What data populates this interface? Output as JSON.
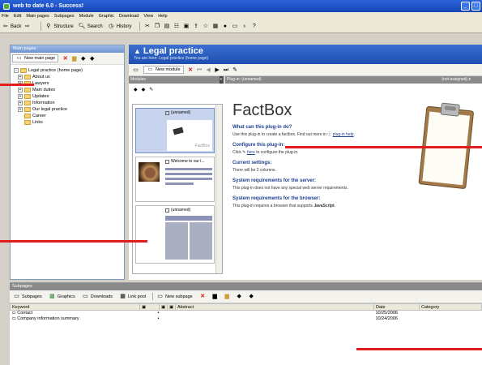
{
  "window": {
    "title": "web to date 6.0 - Success!"
  },
  "menu": [
    "File",
    "Edit",
    "Main pages",
    "Subpages",
    "Module",
    "Graphic",
    "Download",
    "View",
    "Help"
  ],
  "nav": {
    "back": "Back",
    "structure": "Structure",
    "search": "Search",
    "history": "History"
  },
  "left": {
    "header": "Main pages",
    "new_page_button": "New main page",
    "tree": [
      {
        "label": "Legal practice (home page)",
        "expander": "-",
        "level": 0
      },
      {
        "label": "About us",
        "expander": "+",
        "level": 1
      },
      {
        "label": "Lawyers",
        "expander": "+",
        "level": 1
      },
      {
        "label": "Main duties",
        "expander": "+",
        "level": 1
      },
      {
        "label": "Updates",
        "expander": "+",
        "level": 1
      },
      {
        "label": "Information",
        "expander": "+",
        "level": 1
      },
      {
        "label": "Our legal practice",
        "expander": "+",
        "level": 1
      },
      {
        "label": "Career",
        "expander": "",
        "level": 1
      },
      {
        "label": "Links",
        "expander": "",
        "level": 1
      }
    ]
  },
  "main": {
    "title": "Legal practice",
    "breadcrumb": "You are here: Legal practice (home page)",
    "new_module_button": "New module",
    "modules_header": "Modules",
    "plugin_header": "Plug-in: (unnamed)",
    "plugin_status": "(not assigned)",
    "modules": [
      {
        "label": "(unnamed)",
        "preview_text": "FactBox"
      },
      {
        "label": "Welcome to our l..."
      },
      {
        "label": "(unnamed)"
      }
    ],
    "plugin": {
      "title": "FactBox",
      "q1": "What can this plug-in do?",
      "p1": "Use this plug-in to create a factbox. Find out more in",
      "p1_link": "plug-in help",
      "q2": "Configure this plug-in:",
      "p2_pre": "Click",
      "p2_link": "here",
      "p2_post": "to configure the plug-in.",
      "q3": "Current settings:",
      "p3": "There will be 2 columns.",
      "q4": "System requirements for the server:",
      "p4": "This plug-in does not have any special web server requirements.",
      "q5": "System requirements for the browser:",
      "p5_pre": "This plug-in requires a browser that supports",
      "p5_bold": "JavaScript"
    }
  },
  "bottom": {
    "header": "Subpages",
    "toolbar": {
      "subpages": "Subpages",
      "graphics": "Graphics",
      "downloads": "Downloads",
      "linkpool": "Link pool",
      "new_subpage": "New subpage"
    },
    "columns": {
      "keyword": "Keyword",
      "abstract": "Abstract",
      "date": "Date",
      "category": "Category"
    },
    "rows": [
      {
        "keyword": "Contact",
        "mark": "•",
        "date": "10/25/2006"
      },
      {
        "keyword": "Company information summary",
        "mark": "•",
        "date": "10/24/2006"
      }
    ]
  },
  "colors": {
    "titlebar": "#1d4eb0",
    "annotation": "#e01e1e",
    "heading_blue": "#1d3f8c"
  }
}
